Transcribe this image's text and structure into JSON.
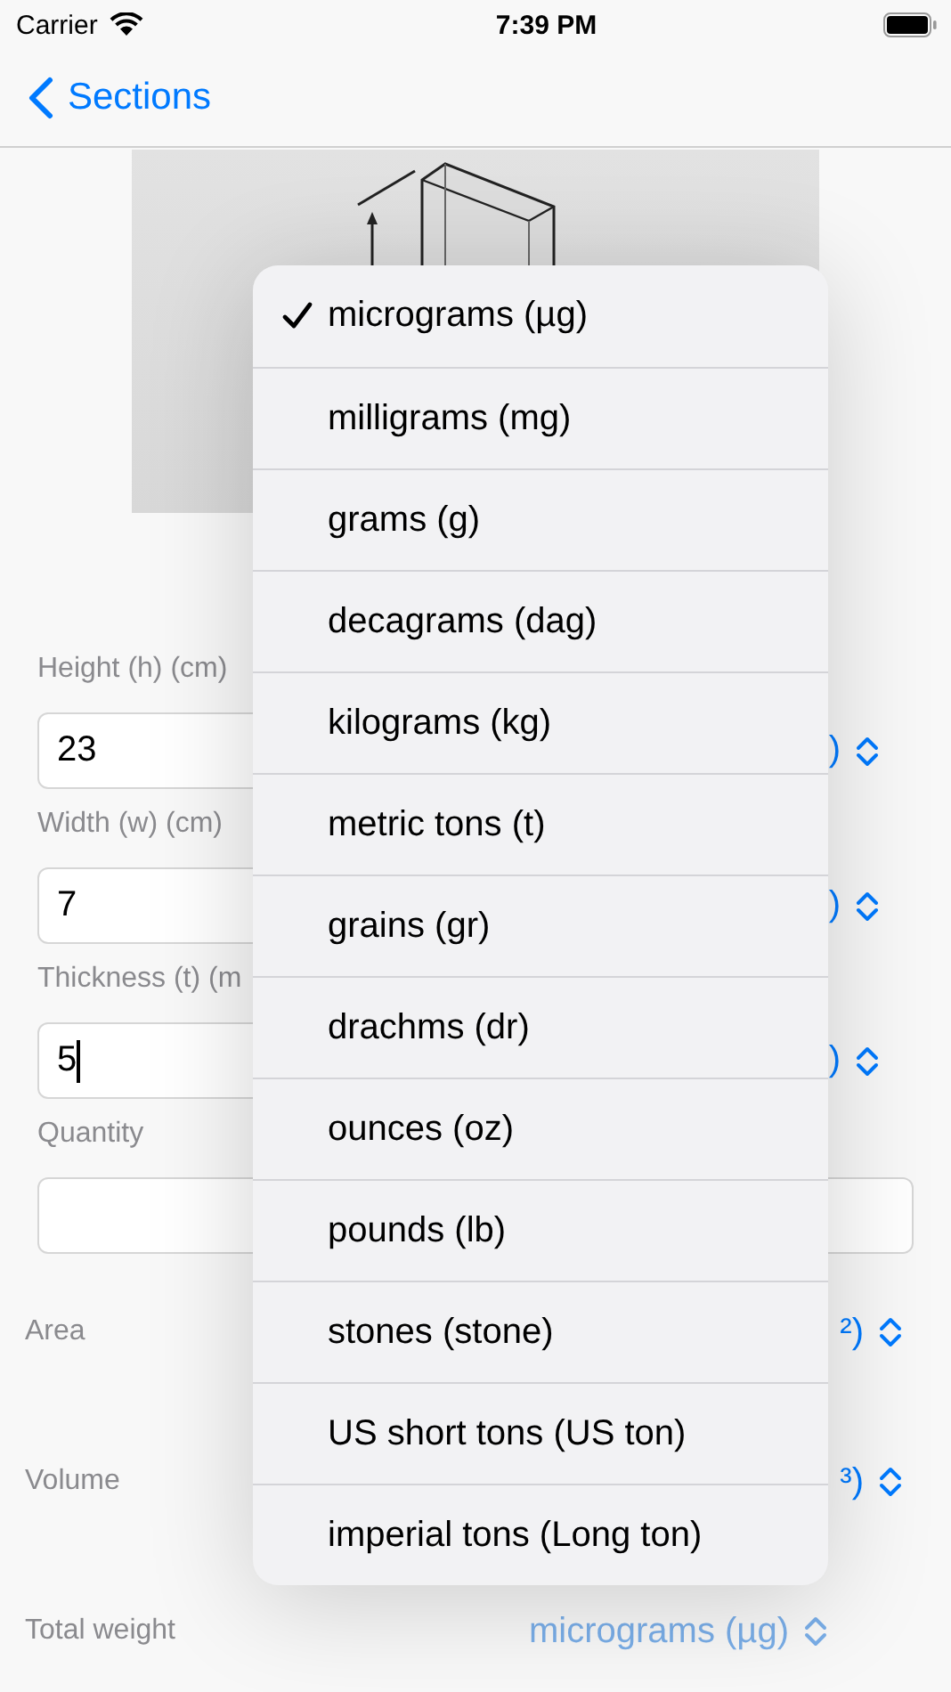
{
  "status_bar": {
    "carrier": "Carrier",
    "time": "7:39 PM"
  },
  "nav": {
    "back_label": "Sections"
  },
  "inputs": [
    {
      "label": "Height (h) (cm)",
      "value": "23",
      "unit": ")",
      "focused": false
    },
    {
      "label": "Width (w) (cm)",
      "value": "7",
      "unit": ")",
      "focused": false
    },
    {
      "label": "Thickness (t) (m",
      "value": "5",
      "unit": ")",
      "focused": true
    }
  ],
  "quantity": {
    "label": "Quantity"
  },
  "results": [
    {
      "label": "Area",
      "unit": "²)"
    },
    {
      "label": "Volume",
      "unit": "³)"
    }
  ],
  "total_weight": {
    "label": "Total weight",
    "unit": "micrograms (µg)"
  },
  "menu": {
    "items": [
      {
        "label": "micrograms (µg)",
        "selected": true
      },
      {
        "label": "milligrams (mg)",
        "selected": false
      },
      {
        "label": "grams (g)",
        "selected": false
      },
      {
        "label": "decagrams (dag)",
        "selected": false
      },
      {
        "label": "kilograms (kg)",
        "selected": false
      },
      {
        "label": "metric tons (t)",
        "selected": false
      },
      {
        "label": "grains (gr)",
        "selected": false
      },
      {
        "label": "drachms (dr)",
        "selected": false
      },
      {
        "label": "ounces (oz)",
        "selected": false
      },
      {
        "label": "pounds (lb)",
        "selected": false
      },
      {
        "label": "stones (stone)",
        "selected": false
      },
      {
        "label": "US short tons (US ton)",
        "selected": false
      },
      {
        "label": "imperial tons (Long ton)",
        "selected": false
      }
    ]
  }
}
